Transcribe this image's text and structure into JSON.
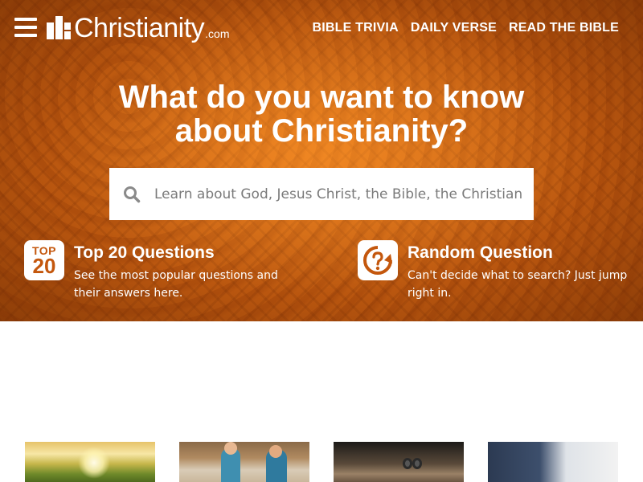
{
  "header": {
    "logo_text": "Christianity",
    "logo_suffix": ".com",
    "nav": [
      {
        "label": "BIBLE TRIVIA"
      },
      {
        "label": "DAILY VERSE"
      },
      {
        "label": "READ THE BIBLE"
      }
    ]
  },
  "hero": {
    "headline_line1": "What do you want to know",
    "headline_line2": "about Christianity?",
    "search": {
      "placeholder": "Learn about God, Jesus Christ, the Bible, the Christian c"
    },
    "features": [
      {
        "icon_top": "TOP",
        "icon_num": "20",
        "title": "Top 20 Questions",
        "description": "See the most popular questions and their answers here."
      },
      {
        "title": "Random Question",
        "description": "Can't decide what to search? Just jump right in."
      }
    ]
  },
  "colors": {
    "accent": "#c4570d",
    "hero_base": "#b9560f",
    "text_on_hero": "#ffffff"
  },
  "icons": [
    "hamburger-menu-icon",
    "search-icon",
    "top-20-icon",
    "random-question-icon"
  ]
}
